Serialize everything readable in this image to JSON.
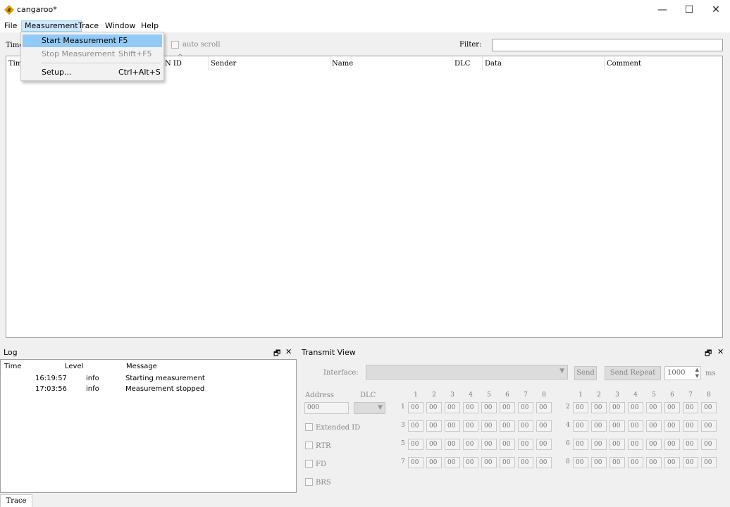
{
  "window": {
    "title": "cangaroo*",
    "controls": {
      "minimize": "—",
      "maximize": "☐",
      "close": "✕"
    }
  },
  "menubar": {
    "items": [
      "File",
      "Measurement",
      "Trace",
      "Window",
      "Help"
    ]
  },
  "measurement_menu": {
    "items": [
      {
        "label": "Start Measurement",
        "shortcut": "F5",
        "state": "highlighted"
      },
      {
        "label": "Stop Measurement",
        "shortcut": "Shift+F5",
        "state": "disabled"
      },
      {
        "label": "Setup...",
        "shortcut": "Ctrl+Alt+S",
        "state": "normal"
      }
    ]
  },
  "trace_toolbar": {
    "time_label": "Time",
    "auto_scroll_label": "auto scroll",
    "filter_label": "Filter:",
    "filter_value": ""
  },
  "trace_table": {
    "columns": [
      "Tim",
      "N ID",
      "Sender",
      "Name",
      "DLC",
      "Data",
      "Comment"
    ]
  },
  "log_panel": {
    "title": "Log",
    "columns": [
      "Time",
      "Level",
      "Message"
    ],
    "rows": [
      {
        "time": "16:19:57",
        "level": "info",
        "message": "Starting measurement"
      },
      {
        "time": "17:03:56",
        "level": "info",
        "message": "Measurement stopped"
      }
    ]
  },
  "transmit_panel": {
    "title": "Transmit View",
    "interface_label": "Interface:",
    "send_label": "Send",
    "send_repeat_label": "Send Repeat",
    "repeat_value": "1000",
    "repeat_unit": "ms",
    "address_label": "Address",
    "address_value": "000",
    "dlc_label": "DLC",
    "extended_id_label": "Extended ID",
    "rtr_label": "RTR",
    "fd_label": "FD",
    "brs_label": "BRS",
    "byte_columns": [
      "1",
      "2",
      "3",
      "4",
      "5",
      "6",
      "7",
      "8"
    ],
    "row_numbers": [
      "1",
      "2",
      "3",
      "4",
      "5",
      "6",
      "7",
      "8"
    ],
    "byte_value": "00"
  },
  "status_tab": {
    "label": "Trace"
  }
}
